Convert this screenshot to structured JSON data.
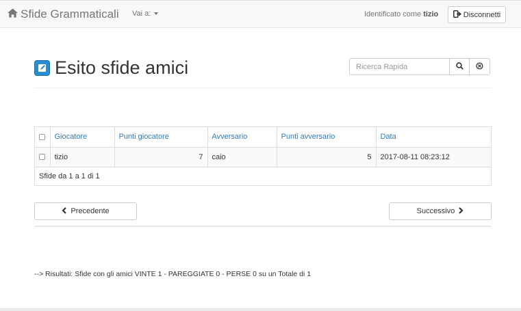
{
  "navbar": {
    "brand": "Sfide Grammaticali",
    "menu_label": "Vai a:",
    "user_prefix": "Identificato come",
    "username": "tizio",
    "logout_label": "Disconnetti"
  },
  "page": {
    "title": "Esito sfide amici",
    "search_placeholder": "Ricerca Rapida"
  },
  "table": {
    "headers": [
      "Giocatore",
      "Punti giocatore",
      "Avversario",
      "Punti avversario",
      "Data"
    ],
    "rows": [
      [
        "tizio",
        "7",
        "caio",
        "5",
        "2017-08-11 08:23:12"
      ]
    ],
    "footer": "Sfide da 1 a 1 di 1"
  },
  "pagination": {
    "prev_label": "Precedente",
    "next_label": "Successivo"
  },
  "results": "--> Risultati: Sfide con gli amici VINTE 1 - PAREGGIATE 0 - PERSE 0 su un Totale di 1",
  "colors": {
    "accent": "#337ab7",
    "navbar_bg": "#f8f8f8"
  }
}
